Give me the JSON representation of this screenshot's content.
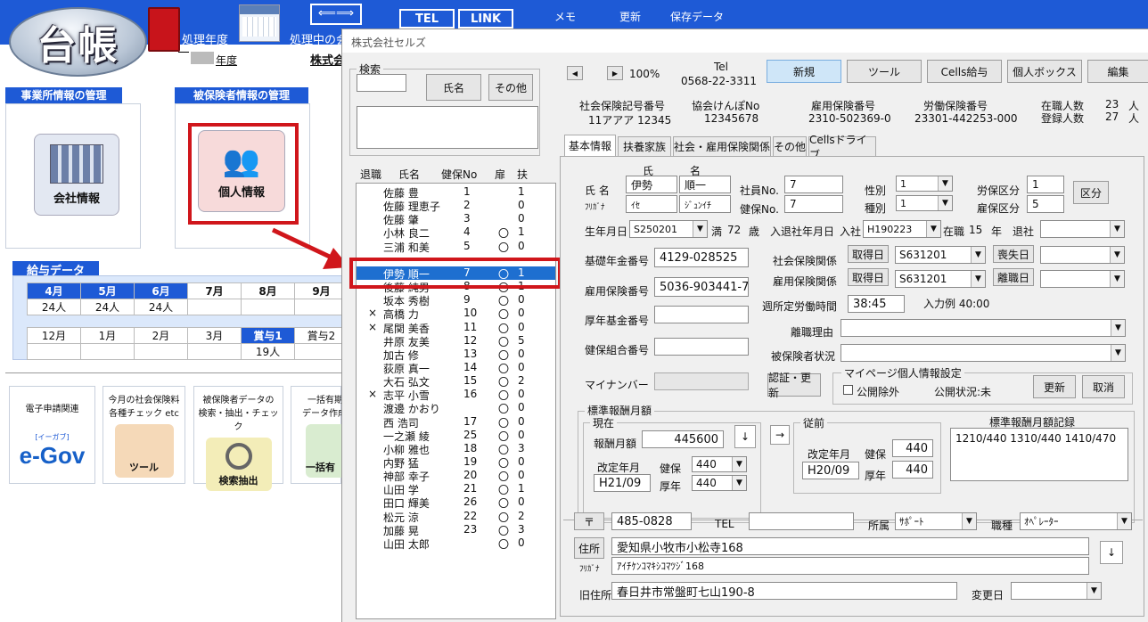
{
  "top": {
    "logo": "台帳",
    "fiscal_year_label": "処理年度",
    "processing_label": "処理中の会",
    "year_suffix": "年度",
    "company_short": "株式会",
    "tel_button": "TEL",
    "link_button": "LINK",
    "memo": "メモ",
    "update": "更新",
    "saved_data": "保存データ"
  },
  "sections": {
    "office": "事業所情報の管理",
    "company_info": "会社情報",
    "insured": "被保険者情報の管理",
    "personal_info": "個人情報",
    "payroll": "給与データ"
  },
  "payroll": {
    "row1": [
      "4月",
      "5月",
      "6月",
      "7月",
      "8月",
      "9月"
    ],
    "row1_vals": [
      "24人",
      "24人",
      "24人",
      "",
      "",
      ""
    ],
    "row2": [
      "12月",
      "1月",
      "2月",
      "3月",
      "賞与1",
      "賞与2"
    ],
    "row2_vals": [
      "",
      "",
      "",
      "",
      "19人",
      ""
    ]
  },
  "tools": {
    "egov_label": "電子申請関連",
    "egov_logo": "e-Gov",
    "egov_small": "[イーガブ]",
    "social_line1": "今月の社会保険料",
    "social_line2": "各種チェック etc",
    "tool_label": "ツール",
    "extract_line1": "被保険者データの",
    "extract_line2": "検索・抽出・チェック",
    "extract_button": "検索抽出",
    "batch_line1": "一括有期",
    "batch_line2": "データ作成",
    "batch_button": "一括有"
  },
  "window": {
    "title": "株式会社セルズ",
    "search_label": "検索",
    "name_button": "氏名",
    "other_button": "その他",
    "list_headers": [
      "退職",
      "氏名",
      "健保No",
      "扉",
      "扶"
    ],
    "employees": [
      {
        "ret": "",
        "name": "佐藤 豊",
        "no": "1",
        "mark": "",
        "dep": "1"
      },
      {
        "ret": "",
        "name": "佐藤 理恵子",
        "no": "2",
        "mark": "",
        "dep": "0"
      },
      {
        "ret": "",
        "name": "佐藤 肇",
        "no": "3",
        "mark": "",
        "dep": "0"
      },
      {
        "ret": "",
        "name": "小林 良二",
        "no": "4",
        "mark": "〇",
        "dep": "1"
      },
      {
        "ret": "",
        "name": "三浦 和美",
        "no": "5",
        "mark": "〇",
        "dep": "0"
      },
      {
        "ret": "",
        "name": "",
        "no": "",
        "mark": "",
        "dep": ""
      },
      {
        "ret": "",
        "name": "伊勢 順一",
        "no": "7",
        "mark": "〇",
        "dep": "1"
      },
      {
        "ret": "",
        "name": "後藤 純男",
        "no": "8",
        "mark": "〇",
        "dep": "1"
      },
      {
        "ret": "",
        "name": "坂本 秀樹",
        "no": "9",
        "mark": "〇",
        "dep": "0"
      },
      {
        "ret": "×",
        "name": "高橋 力",
        "no": "10",
        "mark": "〇",
        "dep": "0"
      },
      {
        "ret": "×",
        "name": "尾関 美香",
        "no": "11",
        "mark": "〇",
        "dep": "0"
      },
      {
        "ret": "",
        "name": "井原 友美",
        "no": "12",
        "mark": "〇",
        "dep": "5"
      },
      {
        "ret": "",
        "name": "加古 修",
        "no": "13",
        "mark": "〇",
        "dep": "0"
      },
      {
        "ret": "",
        "name": "荻原 真一",
        "no": "14",
        "mark": "〇",
        "dep": "0"
      },
      {
        "ret": "",
        "name": "大石 弘文",
        "no": "15",
        "mark": "〇",
        "dep": "2"
      },
      {
        "ret": "×",
        "name": "志平 小雪",
        "no": "16",
        "mark": "〇",
        "dep": "0"
      },
      {
        "ret": "",
        "name": "渡邊 かおり",
        "no": "",
        "mark": "〇",
        "dep": "0"
      },
      {
        "ret": "",
        "name": "西 浩司",
        "no": "17",
        "mark": "〇",
        "dep": "0"
      },
      {
        "ret": "",
        "name": "一之瀬 綾",
        "no": "25",
        "mark": "〇",
        "dep": "0"
      },
      {
        "ret": "",
        "name": "小柳 雅也",
        "no": "18",
        "mark": "〇",
        "dep": "3"
      },
      {
        "ret": "",
        "name": "内野 猛",
        "no": "19",
        "mark": "〇",
        "dep": "0"
      },
      {
        "ret": "",
        "name": "神部 幸子",
        "no": "20",
        "mark": "〇",
        "dep": "0"
      },
      {
        "ret": "",
        "name": "山田 学",
        "no": "21",
        "mark": "〇",
        "dep": "1"
      },
      {
        "ret": "",
        "name": "田口 輝美",
        "no": "26",
        "mark": "〇",
        "dep": "0"
      },
      {
        "ret": "",
        "name": "松元 涼",
        "no": "22",
        "mark": "〇",
        "dep": "2"
      },
      {
        "ret": "",
        "name": "加藤 晃",
        "no": "23",
        "mark": "〇",
        "dep": "3"
      },
      {
        "ret": "",
        "name": "山田 太郎",
        "no": "",
        "mark": "〇",
        "dep": "0"
      }
    ],
    "zoom": "100%",
    "tel_label": "Tel",
    "tel_value": "0568-22-3311",
    "buttons": {
      "new": "新規",
      "tools": "ツール",
      "cells_pay": "Cells給与",
      "personal_box": "個人ボックス",
      "edit": "編集"
    },
    "header_info": {
      "social_no_label": "社会保険記号番号",
      "social_no": "11アアア 12345",
      "kyokai_label": "協会けんぽNo",
      "kyokai": "12345678",
      "emp_ins_label": "雇用保険番号",
      "emp_ins": "2310-502369-0",
      "labor_ins_label": "労働保険番号",
      "labor_ins": "23301-442253-000",
      "enrolled_label": "在職人数",
      "enrolled": "23",
      "registered_label": "登録人数",
      "registered": "27",
      "unit": "人"
    },
    "tabs": [
      "基本情報",
      "扶養家族",
      "社会・雇用保険関係",
      "その他",
      "Cellsドライブ"
    ],
    "form": {
      "sei": "氏",
      "mei": "名",
      "name_label": "氏 名",
      "kana_label": "ﾌﾘｶﾞﾅ",
      "last": "伊勢",
      "first": "順一",
      "last_kana": "ｲｾ",
      "first_kana": "ｼﾞｭﾝｲﾁ",
      "emp_no_label": "社員No.",
      "emp_no": "7",
      "health_no_label": "健保No.",
      "health_no": "7",
      "gender_label": "性別",
      "gender": "1",
      "kind_label": "種別",
      "kind": "1",
      "labor_class_label": "労保区分",
      "labor_class": "1",
      "emp_class_label": "雇保区分",
      "emp_class": "5",
      "class_button": "区分",
      "birth_label": "生年月日",
      "birth": "S250201",
      "age_prefix": "満",
      "age": "72",
      "age_suffix": "歳",
      "hire_label": "入退社年月日",
      "hire_in": "入社",
      "hire_date": "H190223",
      "tenure_prefix": "在職",
      "tenure": "15",
      "tenure_suffix": "年",
      "leave_label": "退社",
      "pension_label": "基礎年金番号",
      "pension": "4129-028525",
      "social_rel": "社会保険関係",
      "acquire": "取得日",
      "social_date": "S631201",
      "loss": "喪失日",
      "emp_ins_label": "雇用保険番号",
      "emp_ins": "5036-903441-7",
      "emp_rel": "雇用保険関係",
      "emp_date": "S631201",
      "leave": "離職日",
      "weekly_label": "週所定労働時間",
      "weekly": "38:45",
      "example": "入力例 40:00",
      "pension_fund_label": "厚年基金番号",
      "separation_reason": "離職理由",
      "health_assoc_label": "健保組合番号",
      "insured_status": "被保険者状況",
      "mynumber_label": "マイナンバー",
      "auth_button": "認証・更新",
      "mypage_title": "マイページ個人情報設定",
      "private_label": "公開除外",
      "status": "公開状況:未",
      "mp_update": "更新",
      "mp_cancel": "取消",
      "std_title": "標準報酬月額",
      "current": "現在",
      "monthly_label": "報酬月額",
      "monthly": "445600",
      "revised_label": "改定年月",
      "health_label": "健保",
      "health_std": "440",
      "pension_lbl": "厚年",
      "pension_std": "440",
      "revised": "H21/09",
      "down_arrow": "↓",
      "right_arrow": "→",
      "prev": "従前",
      "prev_revised": "H20/09",
      "prev_health": "440",
      "prev_pension": "440",
      "record_label": "標準報酬月額記録",
      "record": "1210/440 1310/440 1410/470",
      "zip_btn": "〒",
      "zip": "485-0828",
      "tel_lbl": "TEL",
      "dept_label": "所属",
      "dept": "ｻﾎﾟｰﾄ",
      "job_label": "職種",
      "job": "ｵﾍﾟﾚｰﾀｰ",
      "address_btn": "住所",
      "address": "愛知県小牧市小松寺168",
      "furigana": "ﾌﾘｶﾞﾅ",
      "address_kana": "ｱｲﾁｹﾝｺﾏｷｼｺﾏﾂｼﾞ168",
      "old_address_label": "旧住所",
      "old_address": "春日井市常盤町七山190-8",
      "change_date": "変更日"
    }
  },
  "colors": {
    "header_blue": "#1e5ad6",
    "highlight_red": "#d0161b",
    "selection": "#1e6fd0"
  }
}
